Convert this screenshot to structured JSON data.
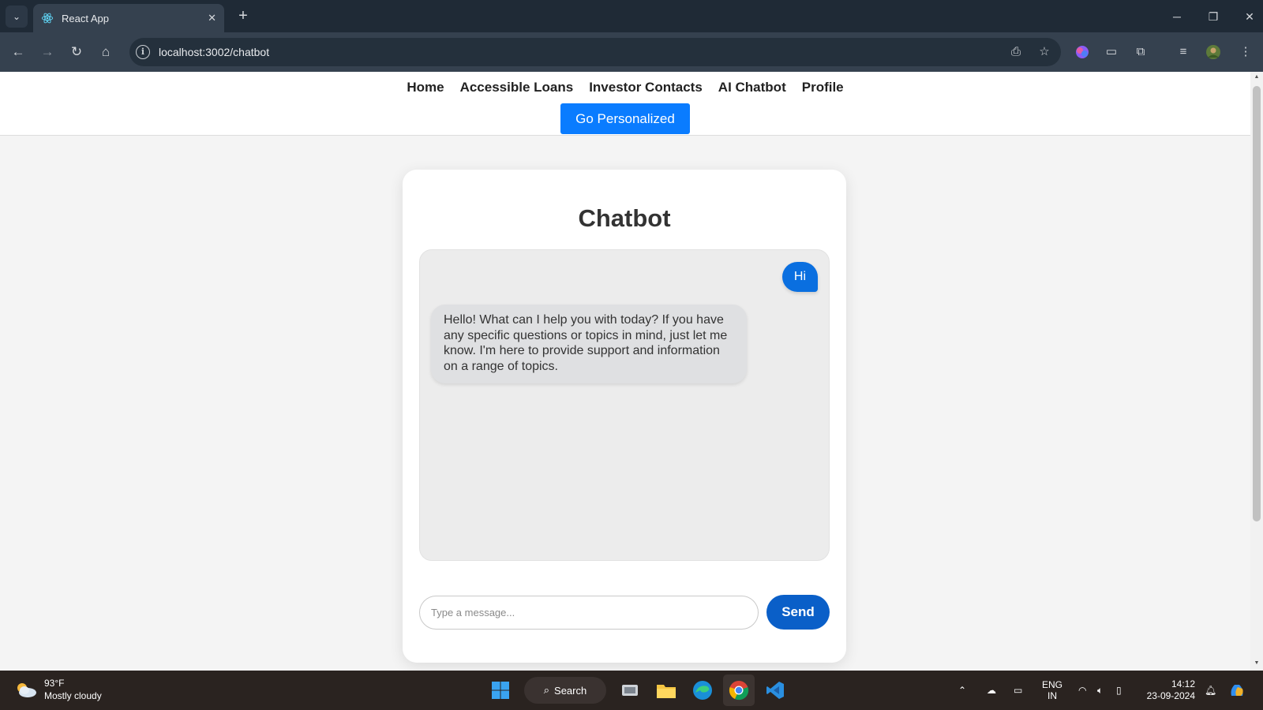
{
  "browser": {
    "tab_title": "React App",
    "url": "localhost:3002/chatbot"
  },
  "nav": {
    "links": [
      "Home",
      "Accessible Loans",
      "Investor Contacts",
      "AI Chatbot",
      "Profile"
    ],
    "cta": "Go Personalized"
  },
  "chat": {
    "title": "Chatbot",
    "messages": [
      {
        "role": "user",
        "text": "Hi"
      },
      {
        "role": "bot",
        "text": "Hello! What can I help you with today? If you have any specific questions or topics in mind, just let me know. I'm here to provide support and information on a range of topics."
      }
    ],
    "input_placeholder": "Type a message...",
    "send_label": "Send"
  },
  "taskbar": {
    "weather_temp": "93°F",
    "weather_desc": "Mostly cloudy",
    "search_label": "Search",
    "lang": "ENG",
    "region": "IN",
    "time": "14:12",
    "date": "23-09-2024"
  },
  "colors": {
    "primary": "#0a7cff",
    "send": "#0a5fc8",
    "user_bubble": "#0a6fe0"
  }
}
